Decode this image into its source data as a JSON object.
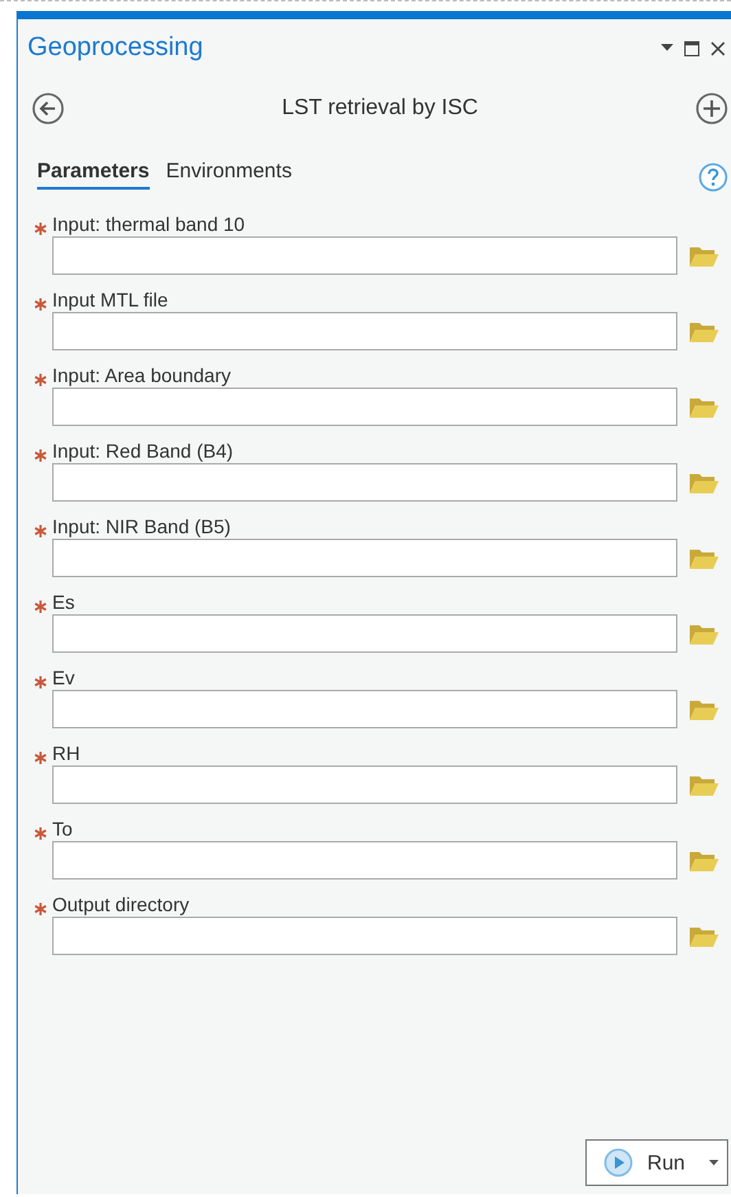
{
  "window": {
    "title": "Geoprocessing"
  },
  "tool": {
    "title": "LST retrieval by ISC"
  },
  "tabs": [
    {
      "label": "Parameters",
      "selected": true
    },
    {
      "label": "Environments",
      "selected": false
    }
  ],
  "parameters": [
    {
      "label": "Input: thermal band 10",
      "required": true
    },
    {
      "label": "Input MTL file",
      "required": true
    },
    {
      "label": "Input: Area boundary",
      "required": true
    },
    {
      "label": "Input: Red Band (B4)",
      "required": true
    },
    {
      "label": "Input: NIR Band (B5)",
      "required": true
    },
    {
      "label": "Es",
      "required": true
    },
    {
      "label": "Ev",
      "required": true
    },
    {
      "label": "RH",
      "required": true
    },
    {
      "label": "To",
      "required": true
    },
    {
      "label": "Output directory",
      "required": true
    }
  ],
  "run_button": {
    "label": "Run"
  }
}
